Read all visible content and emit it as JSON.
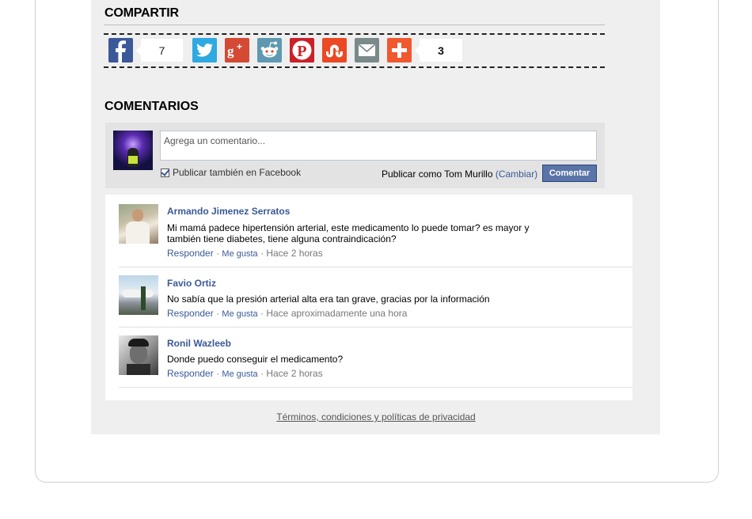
{
  "share": {
    "heading": "COMPARTIR",
    "buttons": [
      {
        "icon": "facebook-icon",
        "color": "#3b5998"
      },
      {
        "icon": "twitter-icon",
        "color": "#2fa9e1"
      },
      {
        "icon": "google-plus-icon",
        "color": "#d44a35"
      },
      {
        "icon": "reddit-icon",
        "color": "#5f99b1"
      },
      {
        "icon": "pinterest-icon",
        "color": "#cb2027"
      },
      {
        "icon": "stumbleupon-icon",
        "color": "#eb4923"
      },
      {
        "icon": "email-icon",
        "color": "#7a8a8a"
      },
      {
        "icon": "addthis-plus-icon",
        "color": "#f1582f"
      }
    ],
    "facebook_count": "7",
    "total_count": "3"
  },
  "comments": {
    "heading": "COMENTARIOS",
    "input_placeholder": "Agrega un comentario...",
    "post_to_facebook_label": "Publicar también en Facebook",
    "post_as_prefix": "Publicar como Tom Murillo",
    "change_label": "(Cambiar)",
    "submit_label": "Comentar",
    "items": [
      {
        "author": "Armando Jimenez Serratos",
        "text": "Mi mamá padece hipertensión arterial, este medicamento lo puede tomar? es mayor y también tiene diabetes, tiene alguna contraindicación?",
        "reply": "Responder",
        "like": "Me gusta",
        "time": "Hace 2 horas"
      },
      {
        "author": "Favio Ortiz",
        "text": "No sabía que la presión arterial alta era tan grave, gracias por la información",
        "reply": "Responder",
        "like": "Me gusta",
        "time": "Hace aproximadamente una hora"
      },
      {
        "author": "Ronil Wazleeb",
        "text": "Donde puedo conseguir el medicamento?",
        "reply": "Responder",
        "like": "Me gusta",
        "time": "Hace 2 horas"
      }
    ]
  },
  "footer": {
    "terms_link": "Términos, condiciones y políticas de privacidad"
  }
}
